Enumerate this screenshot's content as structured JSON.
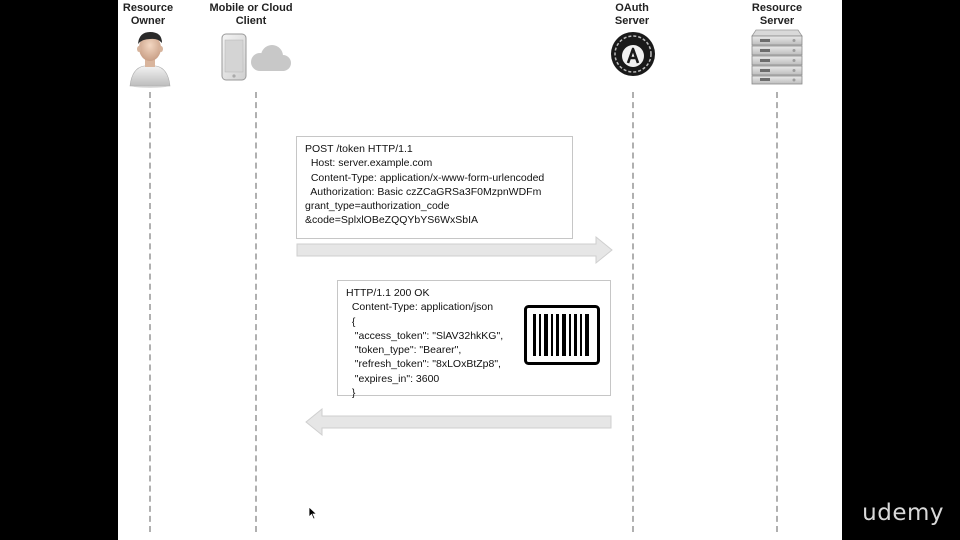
{
  "actors": [
    {
      "id": "owner",
      "label": "Resource\nOwner",
      "icon": "person-icon"
    },
    {
      "id": "client",
      "label": "Mobile or Cloud\nClient",
      "icon": "phone-cloud-icon"
    },
    {
      "id": "oauth",
      "label": "OAuth\nServer",
      "icon": "oauth-logo-icon"
    },
    {
      "id": "resource",
      "label": "Resource\nServer",
      "icon": "server-rack-icon"
    }
  ],
  "request": {
    "lines": [
      "POST /token HTTP/1.1",
      "  Host: server.example.com",
      "  Content-Type: application/x-www-form-urlencoded",
      "  Authorization: Basic czZCaGRSa3F0MzpnWDFm",
      "",
      "grant_type=authorization_code",
      "&code=SplxlOBeZQQYbYS6WxSbIA"
    ]
  },
  "response": {
    "lines": [
      "HTTP/1.1 200 OK",
      "  Content-Type: application/json",
      "  {",
      "   \"access_token\": \"SlAV32hkKG\",",
      "   \"token_type\": \"Bearer\",",
      "   \"refresh_token\": \"8xLOxBtZp8\",",
      "   \"expires_in\": 3600",
      "  }"
    ],
    "badge_icon": "barcode-icon"
  },
  "watermark": "udemy",
  "colors": {
    "lifeline": "#b0b0b0",
    "arrow_fill": "#e6e6e6",
    "arrow_stroke": "#cfcfcf"
  }
}
